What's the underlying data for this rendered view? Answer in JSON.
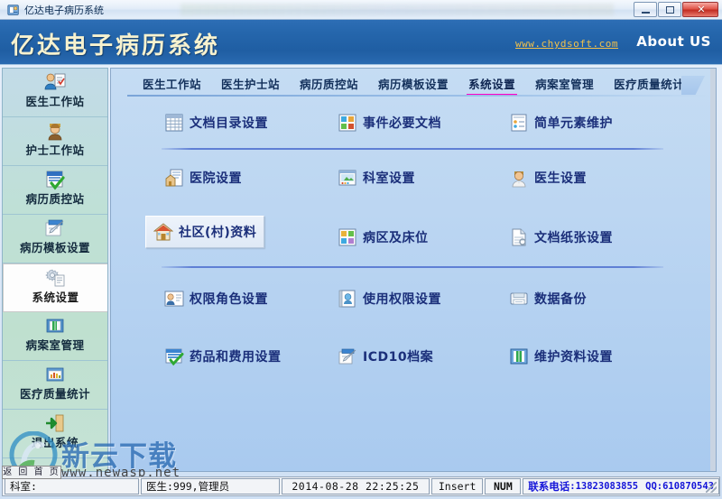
{
  "window": {
    "title": "亿达电子病历系统",
    "icon": "app-icon",
    "controls": {
      "minimize": "–",
      "maximize": "□",
      "close": "✕"
    }
  },
  "header": {
    "logo": "亿达电子病历系统",
    "site_link": "www.chydsoft.com",
    "about": "About US"
  },
  "sidebar": {
    "items": [
      {
        "label": "医生工作站",
        "icon": "doctor-icon",
        "active": false
      },
      {
        "label": "护士工作站",
        "icon": "nurse-icon",
        "active": false
      },
      {
        "label": "病历质控站",
        "icon": "quality-check-icon",
        "active": false
      },
      {
        "label": "病历模板设置",
        "icon": "template-icon",
        "active": false
      },
      {
        "label": "系统设置",
        "icon": "gear-document-icon",
        "active": true
      },
      {
        "label": "病案室管理",
        "icon": "folder-book-icon",
        "active": false
      },
      {
        "label": "医疗质量统计",
        "icon": "chart-folder-icon",
        "active": false
      },
      {
        "label": "退出系统",
        "icon": "exit-door-icon",
        "active": false
      }
    ]
  },
  "tabs": [
    {
      "label": "医生工作站",
      "active": false
    },
    {
      "label": "医生护士站",
      "active": false
    },
    {
      "label": "病历质控站",
      "active": false
    },
    {
      "label": "病历模板设置",
      "active": false
    },
    {
      "label": "系统设置",
      "active": true
    },
    {
      "label": "病案室管理",
      "active": false
    },
    {
      "label": "医疗质量统计",
      "active": false
    }
  ],
  "main": {
    "rows": [
      {
        "divider_after": true,
        "cells": [
          {
            "label": "文档目录设置",
            "icon": "table-grid-icon",
            "hover": false
          },
          {
            "label": "事件必要文档",
            "icon": "colored-blocks-icon",
            "hover": false
          },
          {
            "label": "简单元素维护",
            "icon": "list-items-icon",
            "hover": false
          }
        ]
      },
      {
        "divider_after": false,
        "cells": [
          {
            "label": "医院设置",
            "icon": "hospital-icon",
            "hover": false
          },
          {
            "label": "科室设置",
            "icon": "department-window-icon",
            "hover": false
          },
          {
            "label": "医生设置",
            "icon": "doctor-person-icon",
            "hover": false
          }
        ]
      },
      {
        "divider_after": true,
        "cells": [
          {
            "label": "社区(村)资料",
            "icon": "community-house-icon",
            "hover": true
          },
          {
            "label": "病区及床位",
            "icon": "ward-beds-icon",
            "hover": false
          },
          {
            "label": "文档纸张设置",
            "icon": "paper-page-icon",
            "hover": false
          }
        ]
      },
      {
        "divider_after": false,
        "cells": [
          {
            "label": "权限角色设置",
            "icon": "role-card-icon",
            "hover": false
          },
          {
            "label": "使用权限设置",
            "icon": "permission-book-icon",
            "hover": false
          },
          {
            "label": "数据备份",
            "icon": "backup-disk-icon",
            "hover": false
          }
        ]
      },
      {
        "divider_after": false,
        "cells": [
          {
            "label": "药品和费用设置",
            "icon": "drug-check-icon",
            "hover": false
          },
          {
            "label": "ICD10档案",
            "icon": "icd-edit-icon",
            "hover": false
          },
          {
            "label": "维护资料设置",
            "icon": "green-book-icon",
            "hover": false
          }
        ]
      }
    ]
  },
  "watermark": {
    "text": "新云下载",
    "url": "www.newasp.net",
    "home_button": "返 回 首 页"
  },
  "status": {
    "department": "科室:",
    "doctor": "医生:999,管理员",
    "datetime": "2014-08-28  22:25:25",
    "insert": "Insert",
    "num": "NUM",
    "contact_label": "联系电话",
    "contact_phone": ":13823083855",
    "qq": "QQ:610870543"
  },
  "colors": {
    "banner_blue": "#2566ac",
    "accent_magenta": "#ff00c8",
    "label_blue": "#1b2f7a",
    "link_yellow": "#f2c14a",
    "content_blue": "#bcd6f2"
  }
}
